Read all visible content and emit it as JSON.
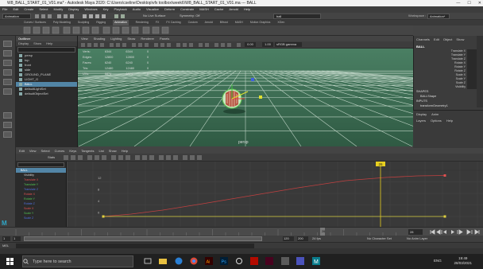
{
  "window": {
    "title": "W8_BALL_START_01_V01.ma* - Autodesk Maya 2020: C:\\Users\\cseline\\Desktop\\vfx toolbox\\week6\\W8_BALL_START_01_V01.ma --- BALL"
  },
  "menubar": [
    "File",
    "Edit",
    "Create",
    "Select",
    "Modify",
    "Display",
    "Windows",
    "Key",
    "Playback",
    "Audio",
    "Visualize",
    "Deform",
    "Constrain",
    "MASH",
    "Cache",
    "Arnold",
    "Help"
  ],
  "statusline": {
    "mode": "Animation",
    "live_surface": "No Live Surface",
    "symmetry": "Symmetry: Off",
    "search": "ball",
    "workspace_label": "Workspace :",
    "workspace_value": "Animation*"
  },
  "shelf_tabs": [
    "Curves / Surfaces",
    "Poly Modeling",
    "Sculpting",
    "Rigging",
    "Animation",
    "Rendering",
    "FX",
    "FX Caching",
    "Custom",
    "Arnold",
    "Bifrost",
    "MASH",
    "Motion Graphics",
    "XGen"
  ],
  "outliner": {
    "title": "Outliner",
    "menu": [
      "Display",
      "Show",
      "Help"
    ],
    "search_placeholder": "Search...",
    "items": [
      {
        "label": "persp",
        "sel": false
      },
      {
        "label": "top",
        "sel": false
      },
      {
        "label": "front",
        "sel": false
      },
      {
        "label": "side",
        "sel": false
      },
      {
        "label": "GROUND_PLANE",
        "sel": false
      },
      {
        "label": "LIGHT_G",
        "sel": false
      },
      {
        "label": "BALL",
        "sel": true
      },
      {
        "label": "defaultLightSet",
        "sel": false
      },
      {
        "label": "defaultObjectSet",
        "sel": false
      }
    ]
  },
  "viewport": {
    "menu": [
      "View",
      "Shading",
      "Lighting",
      "Show",
      "Renderer",
      "Panels"
    ],
    "camera": "persp",
    "gamma_field": "sRGB gamma",
    "exposure": "0.00",
    "gamma": "1.00",
    "hud": {
      "headers": [
        "",
        "",
        "",
        ""
      ],
      "rows": [
        [
          "Verts:",
          "6344",
          "6344",
          "0"
        ],
        [
          "Edges:",
          "12800",
          "12800",
          "0"
        ],
        [
          "Faces:",
          "6240",
          "6240",
          "0"
        ],
        [
          "Tris:",
          "12480",
          "12480",
          "0"
        ],
        [
          "UVs:",
          "6874",
          "6874",
          "0"
        ]
      ]
    }
  },
  "channel_box": {
    "tabs": [
      "Channels",
      "Edit",
      "Object",
      "Show"
    ],
    "object": "BALL",
    "channels": [
      {
        "name": "Translate X",
        "value": "0"
      },
      {
        "name": "Translate Y",
        "value": "0"
      },
      {
        "name": "Translate Z",
        "value": "0"
      },
      {
        "name": "Rotate X",
        "value": "0"
      },
      {
        "name": "Rotate Y",
        "value": "0"
      },
      {
        "name": "Rotate Z",
        "value": "0"
      },
      {
        "name": "Scale X",
        "value": "1"
      },
      {
        "name": "Scale Y",
        "value": "1"
      },
      {
        "name": "Scale Z",
        "value": "1"
      },
      {
        "name": "Visibility",
        "value": "on"
      }
    ],
    "shapes_label": "SHAPES",
    "shape_name": "BALLShape",
    "inputs_label": "INPUTS",
    "input_name": "transformGeometry1"
  },
  "layers": {
    "tabs": [
      "Display",
      "Anim"
    ],
    "menu": [
      "Layers",
      "Options",
      "Help"
    ]
  },
  "graph_editor": {
    "menu": [
      "Edit",
      "View",
      "Select",
      "Curves",
      "Keys",
      "Tangents",
      "List",
      "Show",
      "Help"
    ],
    "stats_label": "Stats",
    "search_placeholder": "Search...",
    "list": [
      {
        "label": "BALL",
        "color": "#ffffff",
        "sel": true
      },
      {
        "label": "Visibility",
        "color": "#cccccc"
      },
      {
        "label": "Translate X",
        "color": "#e05050"
      },
      {
        "label": "Translate Y",
        "color": "#50c050"
      },
      {
        "label": "Translate Z",
        "color": "#5070e0"
      },
      {
        "label": "Rotate X",
        "color": "#e05050"
      },
      {
        "label": "Rotate Y",
        "color": "#50c050"
      },
      {
        "label": "Rotate Z",
        "color": "#5070e0"
      },
      {
        "label": "Scale X",
        "color": "#e05050"
      },
      {
        "label": "Scale Y",
        "color": "#50c050"
      },
      {
        "label": "Scale Z",
        "color": "#5070e0"
      }
    ],
    "y_ticks": [
      "12",
      "8",
      "4",
      "0"
    ],
    "current_frame_label": "26"
  },
  "time_slider": {
    "current": "26",
    "end": "28",
    "ticks": [
      "5",
      "10",
      "15",
      "20",
      "25"
    ]
  },
  "range_slider": {
    "start": "1",
    "start2": "1",
    "end": "120",
    "end2": "200",
    "fps": "24 fps",
    "char_set": "No Character Set",
    "anim_layer": "No Anim Layer"
  },
  "cmdline": {
    "label": "MEL"
  },
  "taskbar": {
    "search": "Type here to search",
    "time": "19:49",
    "date": "28/03/2021",
    "lang": "ENG"
  },
  "colors": {
    "accent": "#5285a6",
    "grid_green": "#2f5a43",
    "curve_red": "#c04040",
    "curve_yellow": "#d8d040",
    "current_time": "#e8d020"
  }
}
